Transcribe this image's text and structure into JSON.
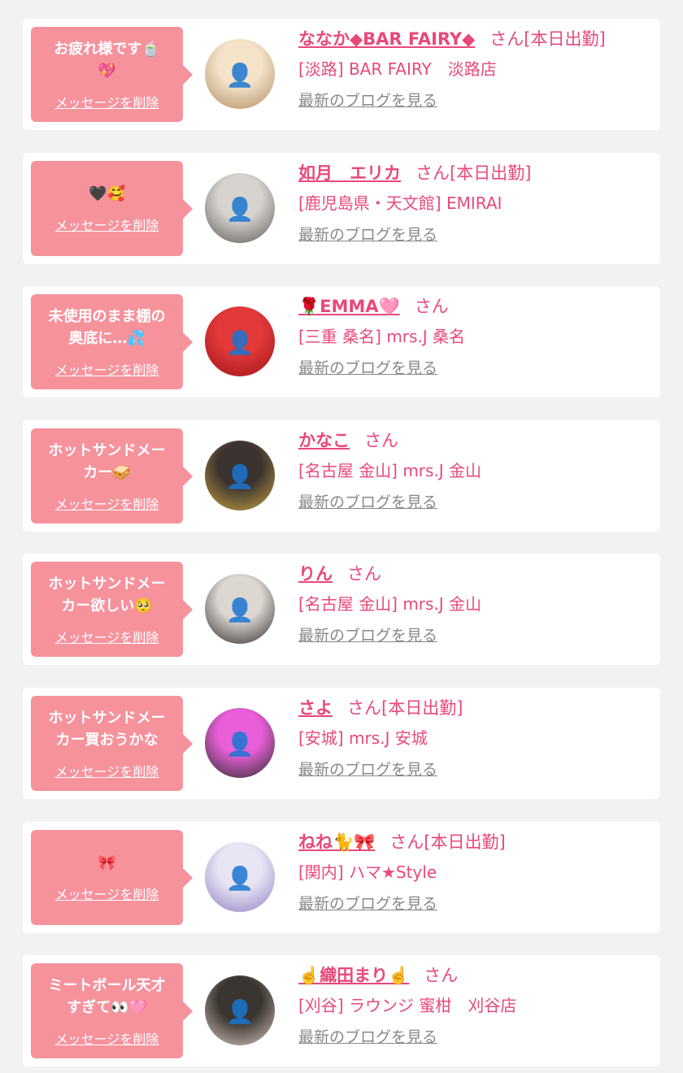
{
  "colors": {
    "page_background": "#f2f2f2",
    "card_background": "#ffffff",
    "bubble": "#f6929c",
    "accent_text": "#e8497a",
    "muted_link": "#888888"
  },
  "common": {
    "delete_label": "メッセージを削除",
    "blog_label": "最新のブログを見る"
  },
  "messages": [
    {
      "message": "お疲れ様です🍵\n💖",
      "name": "ななか◆BAR FAIRY◆",
      "suffix": "さん[本日出勤]",
      "shop": "[淡路] BAR FAIRY　淡路店",
      "avatar_colors": [
        "#f4e3c9",
        "#b08c63"
      ]
    },
    {
      "message": "🖤🥰",
      "name": "如月　エリカ",
      "suffix": "さん[本日出勤]",
      "shop": "[鹿児島県・天文館] EMIRAI",
      "avatar_colors": [
        "#d7d4cf",
        "#5d5a56"
      ]
    },
    {
      "message": "未使用のまま棚の\n奥底に…💦",
      "name": "🌹EMMA🩷",
      "suffix": "さん",
      "shop": "[三重 桑名] mrs.J 桑名",
      "avatar_colors": [
        "#e23a3a",
        "#a01219"
      ]
    },
    {
      "message": "ホットサンドメー\nカー🥪",
      "name": "かなこ",
      "suffix": "さん",
      "shop": "[名古屋 金山] mrs.J 金山",
      "avatar_colors": [
        "#3b3330",
        "#c7a23f"
      ]
    },
    {
      "message": "ホットサンドメー\nカー欲しい🥺",
      "name": "りん",
      "suffix": "さん",
      "shop": "[名古屋 金山] mrs.J 金山",
      "avatar_colors": [
        "#ddd7d2",
        "#2f2a2a"
      ]
    },
    {
      "message": "ホットサンドメー\nカー買おうかな",
      "name": "さよ",
      "suffix": "さん[本日出勤]",
      "shop": "[安城] mrs.J 安城",
      "avatar_colors": [
        "#e95fd9",
        "#2b2b2b"
      ]
    },
    {
      "message": "🎀",
      "name": "ねね🐈🎀",
      "suffix": "さん[本日出勤]",
      "shop": "[関内] ハマ★Style",
      "avatar_colors": [
        "#e9e5f4",
        "#8f7fc2"
      ]
    },
    {
      "message": "ミートボール天才\nすぎて👀🩷",
      "name": "☝️織田まり☝️",
      "suffix": "さん",
      "shop": "[刈谷] ラウンジ 蜜柑　刈谷店",
      "avatar_colors": [
        "#3a3530",
        "#d8c7be"
      ]
    }
  ]
}
